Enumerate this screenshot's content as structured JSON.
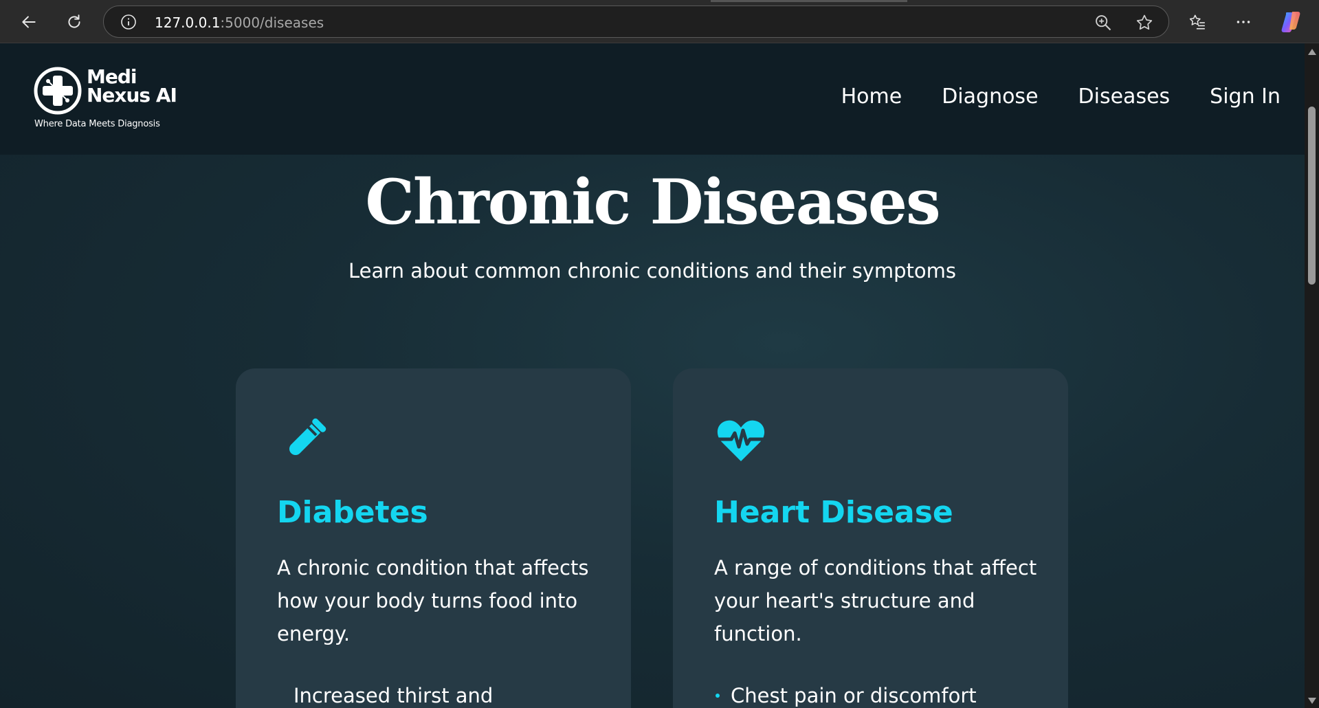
{
  "browser": {
    "url_host": "127.0.0.1",
    "url_path": ":5000/diseases"
  },
  "site": {
    "logo_line1": "Medi",
    "logo_line2": "Nexus AI",
    "tagline": "Where Data Meets Diagnosis",
    "nav": [
      {
        "label": "Home"
      },
      {
        "label": "Diagnose"
      },
      {
        "label": "Diseases"
      },
      {
        "label": "Sign In"
      }
    ]
  },
  "hero": {
    "title": "Chronic Diseases",
    "subtitle": "Learn about common chronic conditions and their symptoms"
  },
  "cards": [
    {
      "icon": "test-tube-icon",
      "title": "Diabetes",
      "description": "A chronic condition that affects how your body turns food into energy.",
      "symptoms": [
        "Increased thirst and"
      ]
    },
    {
      "icon": "heartbeat-icon",
      "title": "Heart Disease",
      "description": "A range of conditions that affect your heart's structure and function.",
      "symptoms": [
        "Chest pain or discomfort"
      ]
    }
  ],
  "colors": {
    "accent": "#14d6f0",
    "card_bg": "#263a45",
    "header_bg": "#0f1d25"
  }
}
